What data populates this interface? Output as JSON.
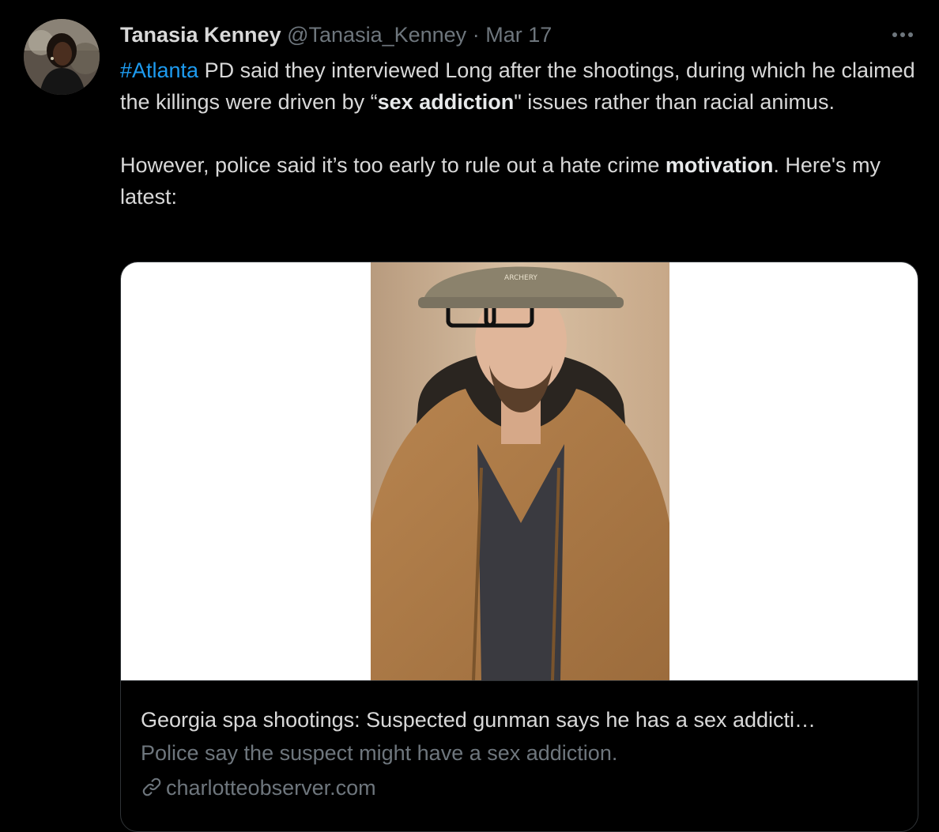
{
  "tweet": {
    "display_name": "Tanasia Kenney",
    "handle": "@Tanasia_Kenney",
    "separator": "·",
    "date": "Mar 17",
    "more_icon": "more-horizontal-icon",
    "text": {
      "hashtag": "#Atlanta",
      "line1_rest": " PD said they interviewed Long after the shootings, during which he claimed the killings were driven by “",
      "bold1": "sex addiction",
      "line1_tail": "\" issues rather than racial animus.",
      "para2_start": "However, police said it’s too early to rule out a hate crime ",
      "bold2": "motivation",
      "para2_tail": ". Here's my latest:"
    }
  },
  "card": {
    "title": "Georgia spa shootings: Suspected gunman says he has a sex addicti…",
    "description": "Police say the suspect might have a sex addiction.",
    "domain": "charlotteobserver.com",
    "domain_icon": "link-icon",
    "photo_hat_text": "ARCHERY"
  },
  "colors": {
    "background": "#000000",
    "text": "#d9d9d9",
    "muted": "#6e767d",
    "link": "#1d9bf0",
    "border": "#2f3336"
  }
}
